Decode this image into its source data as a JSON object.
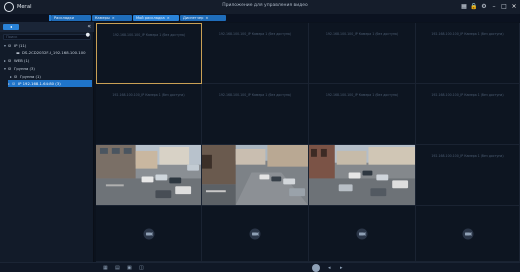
{
  "app": {
    "logo_text": "Мегаl",
    "title": "Приложение для управления видео"
  },
  "window_controls": {
    "grid": "▦",
    "lock": "🔒",
    "settings": "⚙",
    "minimize": "–",
    "maximize": "□",
    "close": "×"
  },
  "tabs": [
    {
      "label": "Раскладки",
      "close": ""
    },
    {
      "label": "Камеры",
      "close": "×"
    },
    {
      "label": "Мой раскладка",
      "close": "×"
    },
    {
      "label": "Диспетчер",
      "close": "×"
    }
  ],
  "sidebar": {
    "toggle_label": "◂",
    "collapse": "«",
    "search_placeholder": "Поиск",
    "search_icon": "●",
    "tree": [
      {
        "twisty": "▾",
        "icon": "⛁",
        "label": "IP (11)"
      },
      {
        "twisty": "",
        "icon": "▬",
        "label": "DS-2CD2032F-I_192.168.100.100"
      },
      {
        "twisty": "▸",
        "icon": "⛁",
        "label": "WEB (1)"
      },
      {
        "twisty": "▾",
        "icon": "⛁",
        "label": "Группа (3)"
      },
      {
        "twisty": "▸",
        "icon": "⛁",
        "label": "Группа (1)"
      },
      {
        "twisty": "▸",
        "icon": "⛁",
        "label": "IP 192.168.1.64:80 (3)"
      }
    ]
  },
  "grid": {
    "cell_label": "192.168.100.100_IP Камера 1 (без доступа)"
  },
  "colors": {
    "accent": "#2a83d8",
    "selected_border": "#c9a055",
    "background": "#0c1320"
  },
  "bottombar": {
    "icon_a": "▦",
    "icon_b": "▤",
    "icon_c": "▣",
    "icon_d": "◫",
    "icon_e": "⬤",
    "icon_f": "◂",
    "icon_g": "▸"
  }
}
